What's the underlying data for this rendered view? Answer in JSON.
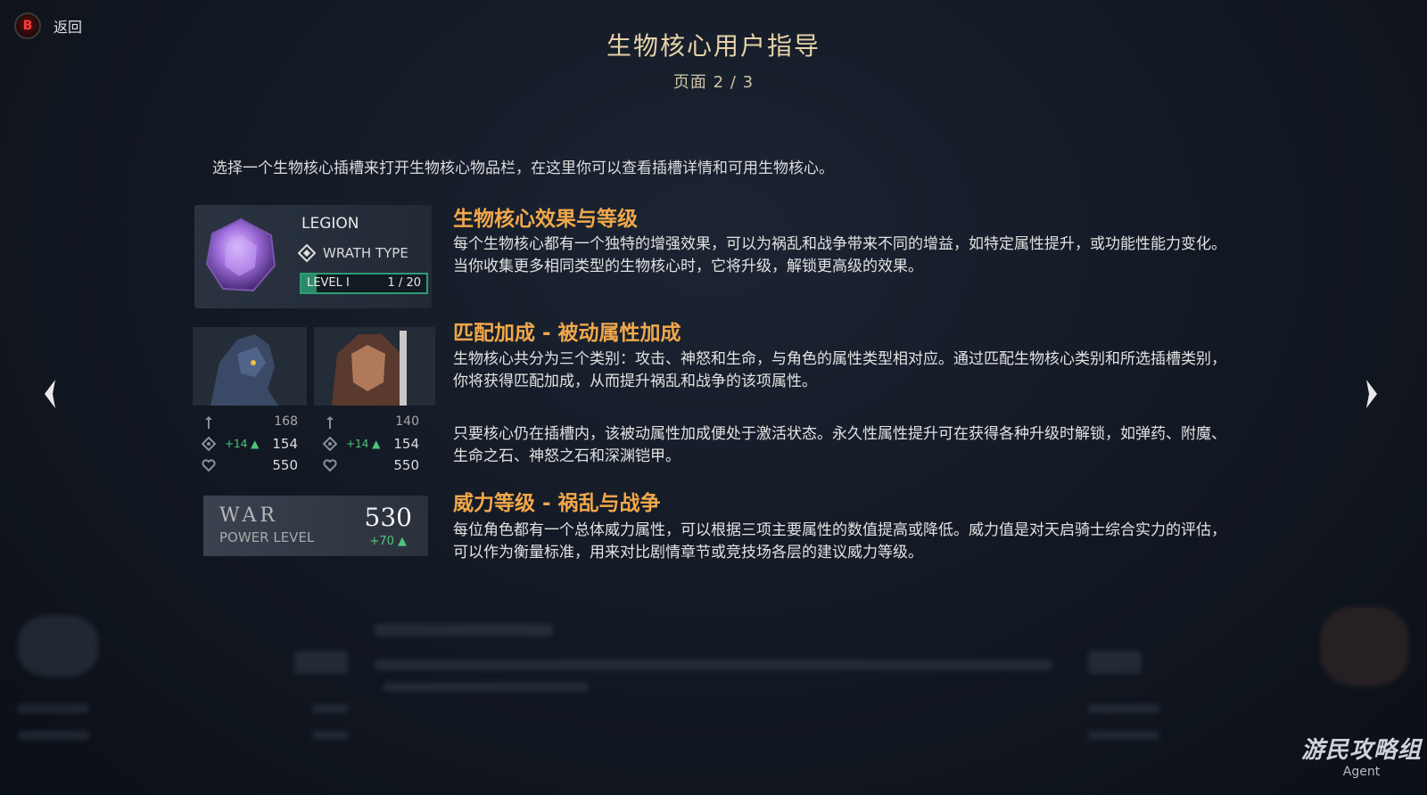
{
  "header": {
    "back_key": "B",
    "back_label": "返回",
    "title": "生物核心用户指导",
    "pager": "页面 2 / 3"
  },
  "intro": "选择一个生物核心插槽来打开生物核心物品栏，在这里你可以查看插槽详情和可用生物核心。",
  "nav": {
    "prev_icon": "chevron-left-icon",
    "next_icon": "chevron-right-icon"
  },
  "card_core": {
    "name": "LEGION",
    "type_label": "WRATH TYPE",
    "level_label": "LEVEL I",
    "level_count": "1 / 20",
    "level_progress": 0.05,
    "accent": "#2e9c74"
  },
  "card_match": {
    "left": [
      {
        "icon": "strength-icon",
        "bonus": "",
        "value": "168"
      },
      {
        "icon": "arcane-icon",
        "bonus": "+14 ▲",
        "value": "154"
      },
      {
        "icon": "health-icon",
        "bonus": "",
        "value": "550"
      }
    ],
    "right": [
      {
        "icon": "strength-icon",
        "bonus": "",
        "value": "140"
      },
      {
        "icon": "arcane-icon",
        "bonus": "+14 ▲",
        "value": "154"
      },
      {
        "icon": "health-icon",
        "bonus": "",
        "value": "550"
      }
    ]
  },
  "card_power": {
    "name": "WAR",
    "label": "POWER LEVEL",
    "value": "530",
    "bonus": "+70 ▲"
  },
  "sections": [
    {
      "title": "生物核心效果与等级",
      "paragraphs": [
        "每个生物核心都有一个独特的增强效果，可以为祸乱和战争带来不同的增益，如特定属性提升，或功能性能力变化。当你收集更多相同类型的生物核心时，它将升级，解锁更高级的效果。"
      ]
    },
    {
      "title": "匹配加成 - 被动属性加成",
      "paragraphs": [
        "生物核心共分为三个类别：攻击、神怒和生命，与角色的属性类型相对应。通过匹配生物核心类别和所选插槽类别，你将获得匹配加成，从而提升祸乱和战争的该项属性。",
        "只要核心仍在插槽内，该被动属性加成便处于激活状态。永久性属性提升可在获得各种升级时解锁，如弹药、附魔、生命之石、神怒之石和深渊铠甲。"
      ]
    },
    {
      "title": "威力等级 - 祸乱与战争",
      "paragraphs": [
        "每位角色都有一个总体威力属性，可以根据三项主要属性的数值提高或降低。威力值是对天启骑士综合实力的评估，可以作为衡量标准，用来对比剧情章节或竞技场各层的建议威力等级。"
      ]
    }
  ],
  "colors": {
    "section_title": "#f0a84a",
    "title": "#e6d3a8",
    "bonus": "#4fc77a",
    "back_key": "#ff3b3b"
  },
  "watermark": {
    "main": "游民攻略组",
    "sub": "Agent"
  }
}
